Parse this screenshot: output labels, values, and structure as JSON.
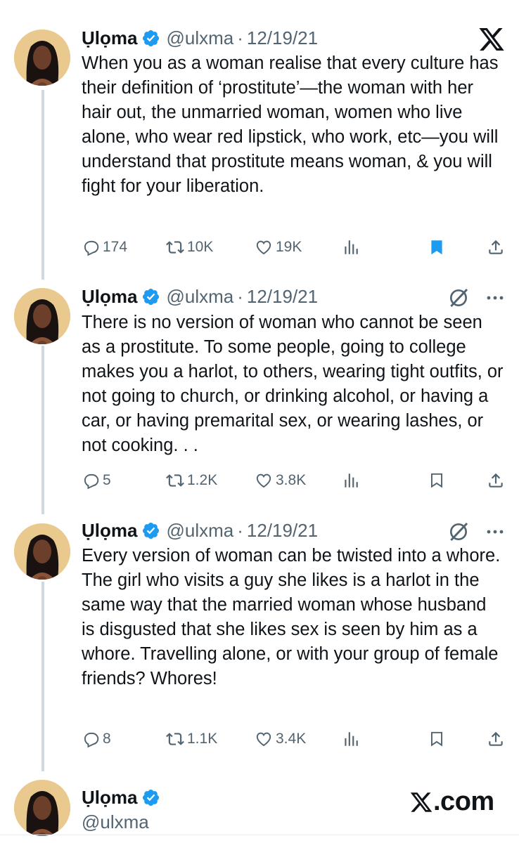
{
  "author": {
    "name": "Ụlọma",
    "handle": "@ulxma",
    "verified": true
  },
  "tweets": [
    {
      "date": "12/19/21",
      "separator": "·",
      "text": "When you as a woman realise that every culture has their definition of ‘prostitute’—the woman with her hair out, the unmarried woman, women who live alone, who wear red lipstick, who work, etc—you will understand that prostitute means woman, & you will fight for your liberation.",
      "replies": "174",
      "reposts": "10K",
      "likes": "19K",
      "bookmarked": true,
      "corner_icon": "x-logo-icon"
    },
    {
      "date": "12/19/21",
      "separator": "·",
      "text": "There is no version of woman who cannot be seen as a prostitute. To some people, going to college makes you a harlot, to others, wearing tight outfits, or not going to church, or drinking alcohol, or having a car, or having premarital sex, or wearing lashes, or not cooking. . .",
      "replies": "5",
      "reposts": "1.2K",
      "likes": "3.8K",
      "bookmarked": false,
      "corner_icon": "grok-icon"
    },
    {
      "date": "12/19/21",
      "separator": "·",
      "text": "Every version of woman can be twisted into a whore. The girl who visits a guy she likes is a harlot in the same way that the married woman whose husband is disgusted that she likes sex is seen by him as a whore. Travelling alone, or with your group of female friends? Whores!",
      "replies": "8",
      "reposts": "1.1K",
      "likes": "3.4K",
      "bookmarked": false,
      "corner_icon": "grok-icon"
    }
  ],
  "footer": {
    "brand_text": ".com"
  },
  "colors": {
    "verified_blue": "#1d9bf0",
    "muted_gray": "#536471",
    "thread_line": "#cfd9de",
    "text": "#0f1419"
  }
}
